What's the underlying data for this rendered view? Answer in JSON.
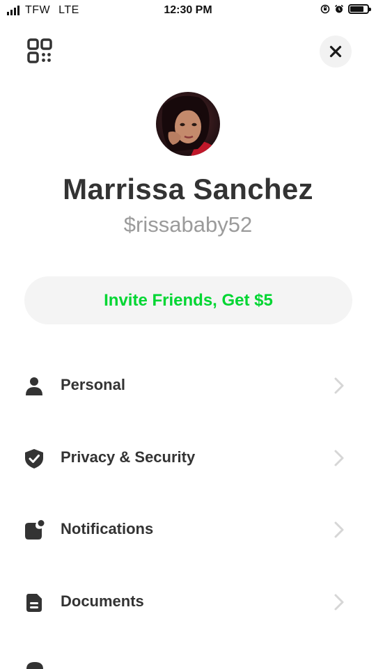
{
  "status_bar": {
    "carrier": "TFW",
    "network": "LTE",
    "time": "12:30 PM",
    "battery_level": 0.8
  },
  "header": {
    "qr_icon": "qr-code-icon",
    "close_icon": "close-icon"
  },
  "profile": {
    "name": "Marrissa Sanchez",
    "handle": "$rissababy52"
  },
  "invite": {
    "label": "Invite Friends, Get $5",
    "color": "#00d632"
  },
  "menu": {
    "items": [
      {
        "label": "Personal",
        "icon": "person-icon"
      },
      {
        "label": "Privacy & Security",
        "icon": "shield-icon"
      },
      {
        "label": "Notifications",
        "icon": "notification-icon"
      },
      {
        "label": "Documents",
        "icon": "document-icon"
      }
    ]
  }
}
